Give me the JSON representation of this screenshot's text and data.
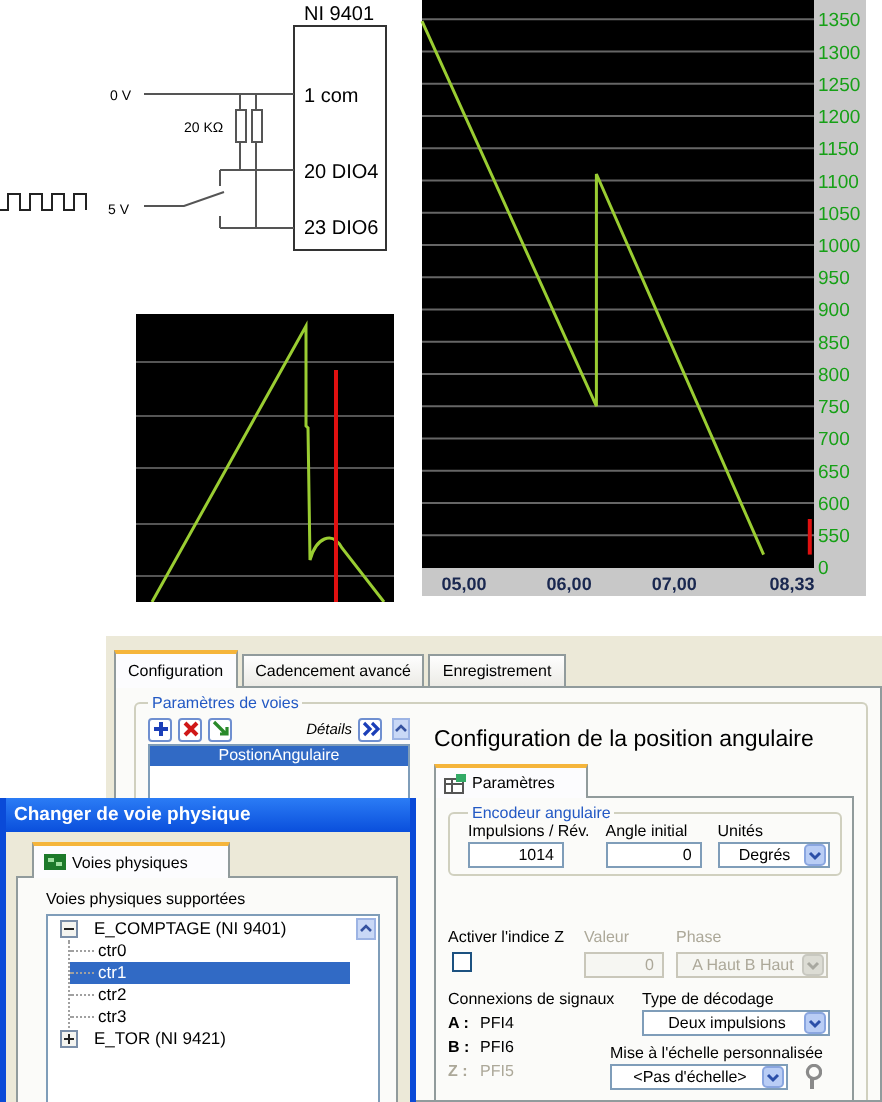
{
  "schematic": {
    "module": "NI 9401",
    "ground_label": "0 V",
    "resistor_label": "20 KΩ",
    "signal_label": "5 V",
    "pins": [
      "1 com",
      "20 DIO4",
      "23 DIO6"
    ]
  },
  "trend_chart": {
    "axis_zero_label": "0",
    "chart_data": {
      "type": "line",
      "grid": true,
      "x": [
        4.6,
        6.26,
        6.26,
        7.85,
        8.29,
        8.29
      ],
      "series": [
        {
          "color": "#9acd32",
          "values": [
            1347,
            750,
            1110,
            520,
            null,
            null
          ]
        },
        {
          "color": "#e01010",
          "values": [
            null,
            null,
            null,
            null,
            520,
            575
          ]
        }
      ],
      "xlim": [
        4.6,
        8.33
      ],
      "ylim": [
        500,
        1380
      ],
      "xticks": [
        {
          "value": 5,
          "label": "05,00"
        },
        {
          "value": 6,
          "label": "06,00"
        },
        {
          "value": 7,
          "label": "07,00"
        },
        {
          "value": 8.33,
          "label": "08,33"
        }
      ],
      "yticks": [
        550,
        600,
        650,
        700,
        750,
        800,
        850,
        900,
        950,
        1000,
        1050,
        1100,
        1150,
        1200,
        1250,
        1300,
        1350
      ]
    }
  },
  "config_window": {
    "tabs": [
      {
        "label": "Configuration",
        "selected": true
      },
      {
        "label": "Cadencement avancé",
        "selected": false
      },
      {
        "label": "Enregistrement",
        "selected": false
      }
    ],
    "channel_group": {
      "title": "Paramètres de voies",
      "toolbar": [
        {
          "kind": "add"
        },
        {
          "kind": "delete"
        },
        {
          "kind": "change"
        }
      ],
      "details_label": "Détails",
      "channels": [
        {
          "name": "PostionAngulaire",
          "selected": true
        }
      ]
    },
    "panel_title": "Configuration de la position angulaire",
    "subtabs": [
      {
        "label": "Paramètres",
        "selected": true
      }
    ],
    "encoder": {
      "title": "Encodeur angulaire",
      "fields": [
        {
          "kind": "number",
          "label": "Impulsions / Rév.",
          "value": "1014"
        },
        {
          "kind": "number",
          "label": "Angle initial",
          "value": "0"
        },
        {
          "kind": "dropdown",
          "label": "Unités",
          "value": "Degrés"
        }
      ]
    },
    "z_index": {
      "label": "Activer l'indice Z",
      "checked": false,
      "value_label": "Valeur",
      "value": "0",
      "phase_label": "Phase",
      "phase": "A Haut B Haut",
      "disabled": true
    },
    "signals": {
      "title": "Connexions de signaux",
      "rows": [
        {
          "pin": "A :",
          "source": "PFI4",
          "disabled": false
        },
        {
          "pin": "B :",
          "source": "PFI6",
          "disabled": false
        },
        {
          "pin": "Z :",
          "source": "PFI5",
          "disabled": true
        }
      ]
    },
    "decoding": {
      "label": "Type de décodage",
      "value": "Deux impulsions"
    },
    "scaling": {
      "label": "Mise à l'échelle personnalisée",
      "value": "<Pas d'échelle>"
    }
  },
  "dialog": {
    "title": "Changer de voie physique",
    "tabs": [
      {
        "label": "Voies physiques",
        "selected": true
      }
    ],
    "tree_label": "Voies physiques supportées",
    "tree": [
      {
        "label": "E_COMPTAGE (NI 9401)",
        "expanded": true,
        "selected": false,
        "children": [
          {
            "label": "ctr0",
            "selected": false
          },
          {
            "label": "ctr1",
            "selected": true
          },
          {
            "label": "ctr2",
            "selected": false
          },
          {
            "label": "ctr3",
            "selected": false
          }
        ]
      },
      {
        "label": "E_TOR (NI 9421)",
        "expanded": false,
        "selected": false
      }
    ]
  }
}
